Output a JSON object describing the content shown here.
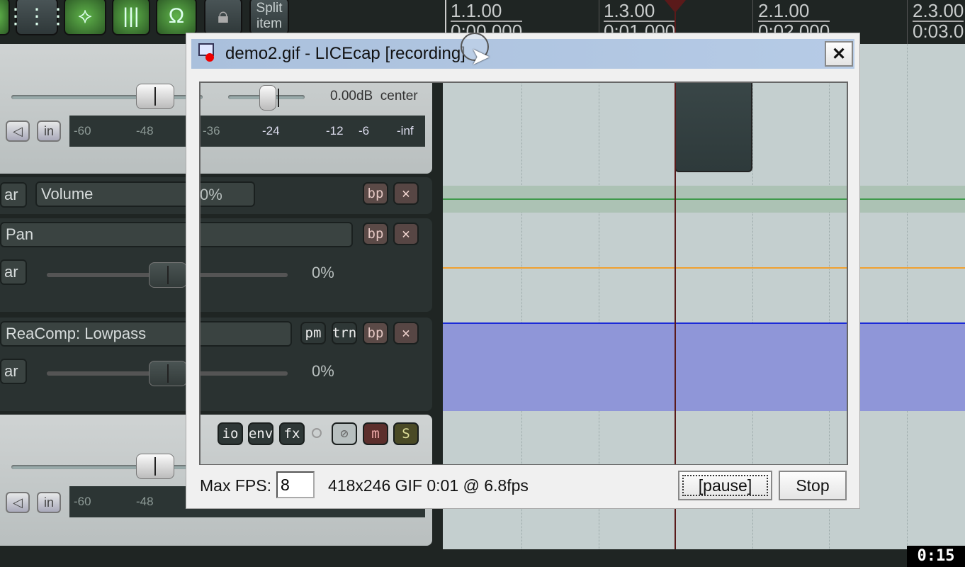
{
  "toolbar": {
    "buttons": [
      {
        "icon": "grid-icon"
      },
      {
        "icon": "ripple-edit-icon"
      },
      {
        "icon": "grid-lines-icon"
      },
      {
        "icon": "snap-magnet-icon"
      },
      {
        "icon": "lock-icon"
      }
    ],
    "split_item": "Split\nitem"
  },
  "ruler": {
    "marks": [
      {
        "bar": "1.1.00",
        "time": "0:00.000"
      },
      {
        "bar": "1.3.00",
        "time": "0:01.000"
      },
      {
        "bar": "2.1.00",
        "time": "0:02.000"
      },
      {
        "bar": "2.3.00",
        "time": "0:03.0"
      }
    ]
  },
  "track1": {
    "volume_readout": "0.00dB",
    "pan_readout": "center",
    "meter_labels": [
      "-60",
      "-48",
      "-36",
      "-24",
      "-12",
      "-6",
      "-inf"
    ],
    "mute_icon": "speaker-icon",
    "in_label": "in"
  },
  "envelopes": [
    {
      "name": "Volume",
      "value": "0%",
      "ar": "ar",
      "bp": "bp",
      "x": "✕"
    },
    {
      "name": "Pan",
      "value": "0%",
      "ar": "ar",
      "bp": "bp",
      "x": "✕"
    },
    {
      "name": "ReaComp: Lowpass",
      "value": "0%",
      "ar": "ar",
      "pm": "pm",
      "trn": "trn",
      "bp": "bp",
      "x": "✕"
    }
  ],
  "track2": {
    "buttons": [
      "io",
      "env",
      "fx",
      "m",
      "S"
    ],
    "meter_labels": [
      "-60",
      "-48"
    ],
    "in_label": "in"
  },
  "colors": {
    "volume_env": "#3f9a4a",
    "pan_env": "#f0a030",
    "fx_env": "#1b2bd8",
    "fx_fill": "#8f96d8",
    "playhead": "#5a1a1a"
  },
  "dialog": {
    "title": "demo2.gif - LICEcap [recording]",
    "close": "✕",
    "max_fps_label": "Max FPS:",
    "max_fps_value": "8",
    "status": "418x246 GIF 0:01 @ 6.8fps",
    "pause": "[pause]",
    "stop": "Stop"
  },
  "timer": "0:15"
}
